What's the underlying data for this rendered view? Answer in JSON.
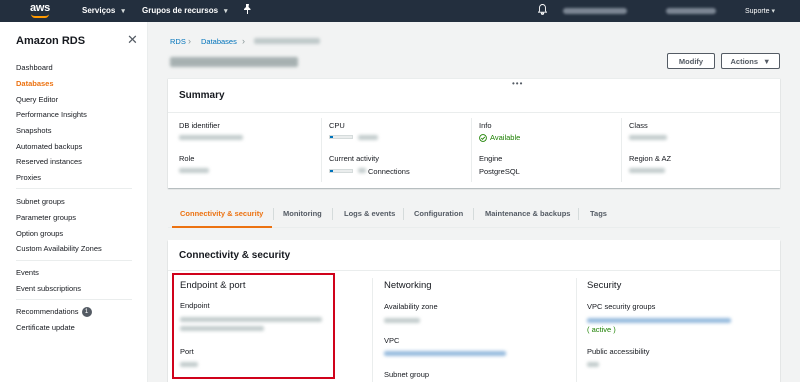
{
  "topnav": {
    "logo": "aws",
    "services": "Serviços",
    "resource_groups": "Grupos de recursos",
    "pin_icon": "pushpin-icon",
    "bell_icon": "bell-icon",
    "support": "Suporte"
  },
  "sidebar": {
    "title": "Amazon RDS",
    "items": [
      {
        "label": "Dashboard"
      },
      {
        "label": "Databases"
      },
      {
        "label": "Query Editor"
      },
      {
        "label": "Performance Insights"
      },
      {
        "label": "Snapshots"
      },
      {
        "label": "Automated backups"
      },
      {
        "label": "Reserved instances"
      },
      {
        "label": "Proxies"
      },
      {
        "label": "Subnet groups"
      },
      {
        "label": "Parameter groups"
      },
      {
        "label": "Option groups"
      },
      {
        "label": "Custom Availability Zones"
      },
      {
        "label": "Events"
      },
      {
        "label": "Event subscriptions"
      },
      {
        "label": "Recommendations"
      },
      {
        "label": "Certificate update"
      }
    ],
    "recommendations_badge": "1"
  },
  "breadcrumb": {
    "rds": "RDS",
    "databases": "Databases"
  },
  "actions": {
    "modify": "Modify",
    "actions": "Actions"
  },
  "summary": {
    "title": "Summary",
    "db_identifier_label": "DB identifier",
    "cpu_label": "CPU",
    "info_label": "Info",
    "info_value": "Available",
    "class_label": "Class",
    "role_label": "Role",
    "current_activity_label": "Current activity",
    "connections_suffix": "Connections",
    "engine_label": "Engine",
    "engine_value": "PostgreSQL",
    "region_label": "Region & AZ"
  },
  "tabs": [
    {
      "label": "Connectivity & security"
    },
    {
      "label": "Monitoring"
    },
    {
      "label": "Logs & events"
    },
    {
      "label": "Configuration"
    },
    {
      "label": "Maintenance & backups"
    },
    {
      "label": "Tags"
    }
  ],
  "connectivity": {
    "title": "Connectivity & security",
    "endpoint_port": {
      "heading": "Endpoint & port",
      "endpoint_label": "Endpoint",
      "port_label": "Port"
    },
    "networking": {
      "heading": "Networking",
      "az_label": "Availability zone",
      "vpc_label": "VPC",
      "subnet_label": "Subnet group"
    },
    "security": {
      "heading": "Security",
      "vpc_sg_label": "VPC security groups",
      "active_text": "( active )",
      "public_access_label": "Public accessibility"
    }
  },
  "colors": {
    "nav_bg": "#232f3e",
    "accent_orange": "#ec7211",
    "link_blue": "#0073bb",
    "status_green": "#1d8102",
    "highlight_red": "#d0021b"
  }
}
